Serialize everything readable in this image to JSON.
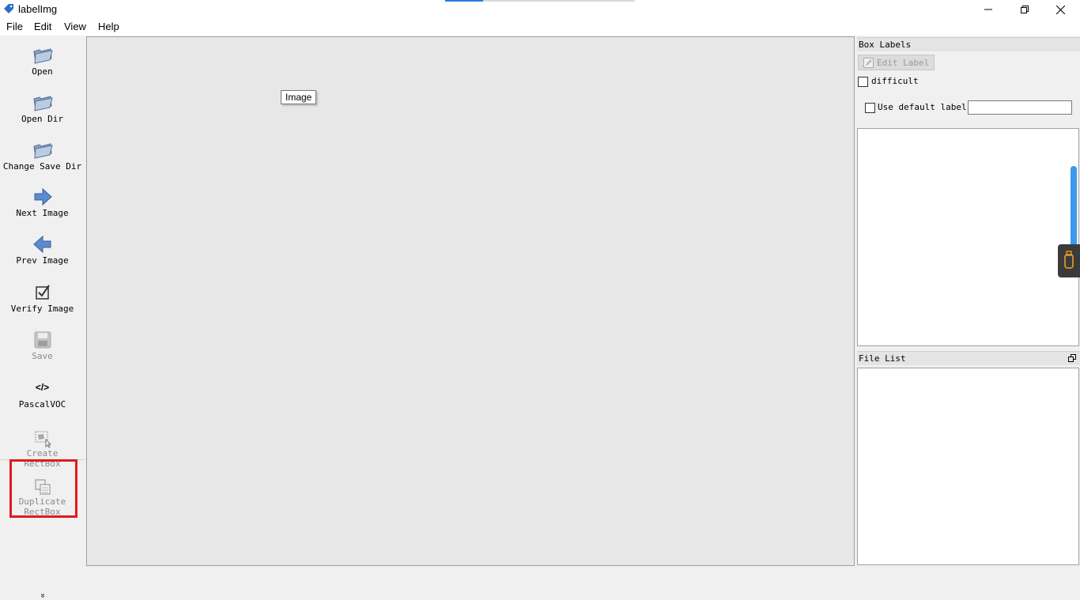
{
  "window": {
    "title": "labelImg",
    "controls": {
      "minimize": "minimize-icon",
      "maximize": "restore-icon",
      "close": "close-icon"
    }
  },
  "menu": {
    "file": "File",
    "edit": "Edit",
    "view": "View",
    "help": "Help"
  },
  "toolbar": {
    "open": "Open",
    "open_dir": "Open Dir",
    "change_save_dir": "Change Save Dir",
    "next_image": "Next Image",
    "prev_image": "Prev Image",
    "verify_image": "Verify Image",
    "save": "Save",
    "pascal_voc_icon_text": "</>",
    "pascal_voc": "PascalVOC",
    "create_rectbox_line1": "Create",
    "create_rectbox_line2": "RectBox",
    "duplicate_rectbox_line1": "Duplicate",
    "duplicate_rectbox_line2": "RectBox",
    "more": "»"
  },
  "canvas": {
    "tooltip": "Image"
  },
  "box_labels": {
    "title": "Box Labels",
    "edit_label_button": "Edit Label",
    "difficult": "difficult",
    "use_default_label": "Use default label",
    "default_label_value": ""
  },
  "file_list": {
    "title": "File List"
  },
  "colors": {
    "highlight": "#e0191f",
    "accent": "#2a7ad6",
    "scroll": "#3a99f0",
    "canvas": "#e7e7e7"
  }
}
